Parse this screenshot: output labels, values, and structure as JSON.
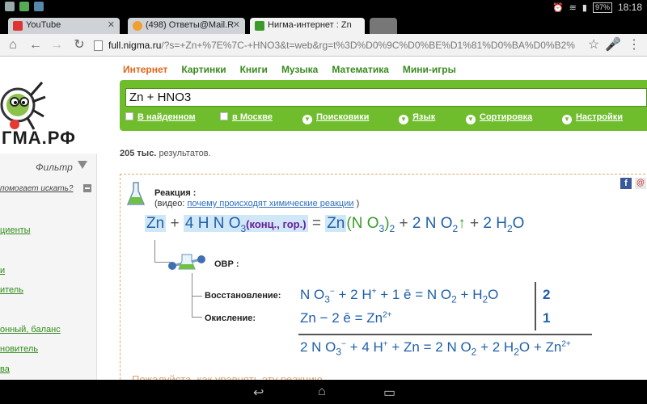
{
  "status_bar": {
    "battery": "97%",
    "time": "18:18"
  },
  "tabs": [
    {
      "title": "YouTube",
      "icon_color": "#d33"
    },
    {
      "title": "(498) Ответы@Mail.R",
      "icon_color": "#f0a030"
    },
    {
      "title": "Нигма-интернет : Zn",
      "icon_color": "#3a9b2a"
    }
  ],
  "address_bar": {
    "host": "full.nigma.ru",
    "path": "/?s=+Zn+%7E%7C-+HNO3&t=web&rg=t%3D%D0%9C%D0%BE%D1%81%D0%BA%D0%B2%"
  },
  "logo": {
    "text": "ГМА.РФ"
  },
  "top_nav": {
    "items": [
      "Интернет",
      "Картинки",
      "Книги",
      "Музыка",
      "Математика",
      "Мини-игры"
    ],
    "active_index": 0
  },
  "search": {
    "query": "Zn + HNO3",
    "options": {
      "in_found": "В найденном",
      "in_moscow": "в Москве",
      "engines": "Поисковики",
      "language": "Язык",
      "sort": "Сортировка",
      "settings": "Настройки"
    }
  },
  "results": {
    "count": "205 тыс.",
    "label": "результатов."
  },
  "sidebar": {
    "filter": "Фильтр",
    "help": "помогает искать?",
    "items": [
      "циенты",
      "и",
      "итель",
      "онный, баланс",
      "новитель",
      "ва"
    ]
  },
  "reaction": {
    "label": "Реакция :",
    "video_prefix": "(видео:",
    "video_link": "почему происходят химические реакции",
    "video_suffix": ")",
    "main": {
      "zn1": "Zn",
      "plus1": "+",
      "hno3": "4 H N O",
      "hno3_sub": "3",
      "cond": "(конц., гор.)",
      "eq": "=",
      "zn2": "Zn",
      "no3_group": "(N O",
      "no3_sub": "3",
      "close_paren": ")",
      "paren_sub": "2",
      "plus2": "+",
      "no2": "2 N O",
      "no2_sub": "2",
      "arrow": "↑",
      "plus3": "+",
      "h2o": "2 H",
      "h2o_sub": "2",
      "h2o_o": "O"
    },
    "ovr_label": "ОВР :",
    "reduction": {
      "label": "Восстановление:",
      "lhs_no3": "N O",
      "lhs_no3_sub": "3",
      "lhs_no3_charge": "−",
      "lhs_h": "+ 2 H",
      "lhs_h_charge": "+",
      "lhs_e": "+ 1 ē",
      "eq": "=",
      "rhs_no2": "N O",
      "rhs_no2_sub": "2",
      "rhs_h2o": "+ H",
      "rhs_h2o_sub": "2",
      "rhs_o": "O",
      "coef": "2"
    },
    "oxidation": {
      "label": "Окисление:",
      "lhs": "Zn − 2 ē",
      "eq": "=",
      "rhs": "Zn",
      "rhs_charge": "2+",
      "coef": "1"
    },
    "sum": {
      "a": "2 N O",
      "a_sub": "3",
      "a_charge": "−",
      "b": "+ 4 H",
      "b_charge": "+",
      "c": "+ Zn",
      "eq": "=",
      "d": "2 N O",
      "d_sub": "2",
      "e": "+ 2 H",
      "e_sub": "2",
      "f": "O + Zn",
      "f_charge": "2+"
    },
    "cutoff_text": "Пожалуйста, как уравнять эту реакцию"
  }
}
